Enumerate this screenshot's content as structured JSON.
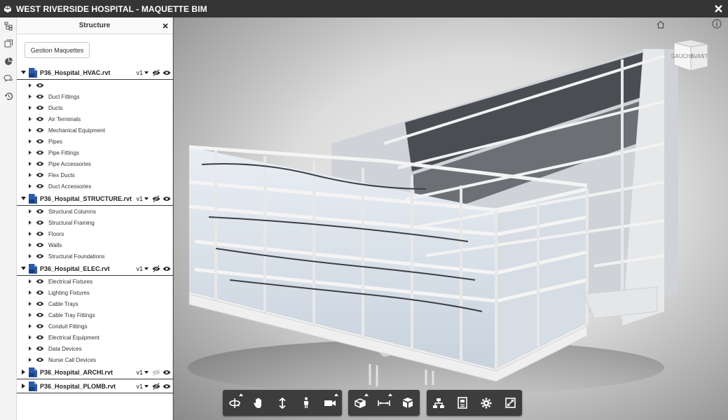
{
  "window": {
    "title": "WEST RIVERSIDE HOSPITAL - MAQUETTE BIM"
  },
  "panel": {
    "title": "Structure",
    "manage_button": "Gestion Maquettes"
  },
  "models": [
    {
      "name": "P36_Hospital_HVAC.rvt",
      "version": "v1",
      "expanded": true,
      "visibility_dimmed": false,
      "categories": [
        "",
        "Duct Fittings",
        "Ducts",
        "Air Terminals",
        "Mechanical Equipment",
        "Pipes",
        "Pipe Fittings",
        "Pipe Accessories",
        "Flex Ducts",
        "Duct Accessories"
      ]
    },
    {
      "name": "P36_Hospital_STRUCTURE.rvt",
      "version": "v1",
      "expanded": true,
      "visibility_dimmed": false,
      "categories": [
        "Structural Columns",
        "Structural Framing",
        "Floors",
        "Walls",
        "Structural Foundations"
      ]
    },
    {
      "name": "P36_Hospital_ELEC.rvt",
      "version": "v1",
      "expanded": true,
      "visibility_dimmed": false,
      "categories": [
        "Electrical Fixtures",
        "Lighting Fixtures",
        "Cable Trays",
        "Cable Tray Fittings",
        "Conduit Fittings",
        "Electrical Equipment",
        "Data Devices",
        "Nurse Call Devices"
      ]
    },
    {
      "name": "P36_Hospital_ARCHI.rvt",
      "version": "v1",
      "expanded": false,
      "visibility_dimmed": true,
      "categories": []
    },
    {
      "name": "P36_Hospital_PLOMB.rvt",
      "version": "v1",
      "expanded": false,
      "visibility_dimmed": false,
      "categories": []
    }
  ],
  "viewcube": {
    "left_face": "GAUCHE",
    "front_face": "AVANT"
  },
  "sidebar_icons": [
    "model-tree-icon",
    "layers-icon",
    "pie-chart-icon",
    "comments-icon",
    "history-icon"
  ],
  "toolbar_groups": [
    [
      "orbit-icon",
      "pan-icon",
      "zoom-icon",
      "walk-icon",
      "camera-icon"
    ],
    [
      "section-icon",
      "measure-icon",
      "explode-icon"
    ],
    [
      "model-browser-icon",
      "properties-icon",
      "settings-icon",
      "fullscreen-icon"
    ]
  ],
  "colors": {
    "titlebar": "#353535",
    "toolbar": "#3d3d3d",
    "rvt_icon": "#2b5aa8"
  }
}
